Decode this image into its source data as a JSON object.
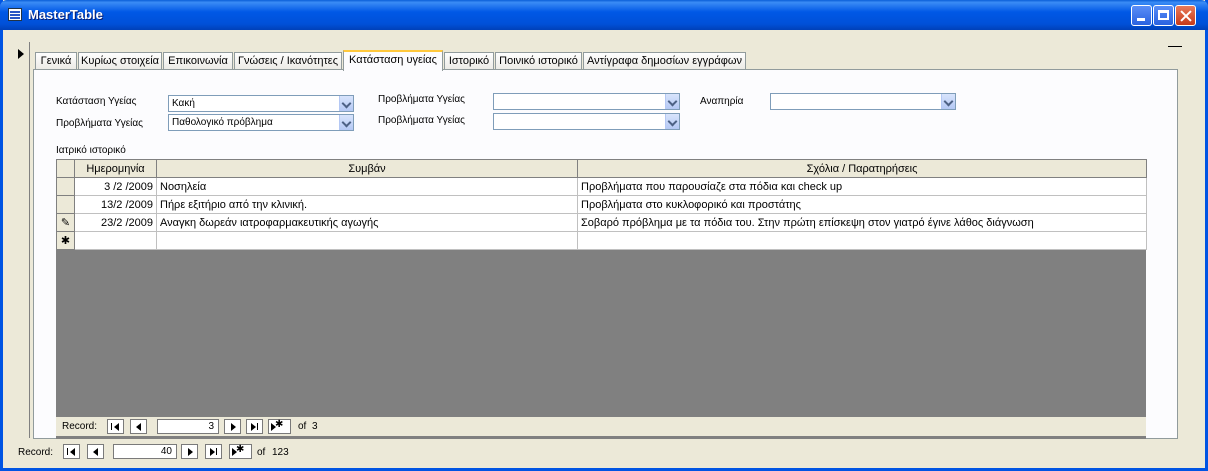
{
  "window": {
    "title": "MasterTable"
  },
  "tabs": [
    {
      "label": "Γενικά"
    },
    {
      "label": "Κυρίως στοιχεία"
    },
    {
      "label": "Επικοινωνία"
    },
    {
      "label": "Γνώσεις / Ικανότητες"
    },
    {
      "label": "Κατάσταση υγείας"
    },
    {
      "label": "Ιστορικό"
    },
    {
      "label": "Ποινικό ιστορικό"
    },
    {
      "label": "Αντίγραφα δημοσίων εγγράφων"
    }
  ],
  "active_tab": "Κατάσταση υγείας",
  "form": {
    "health_status_label": "Κατάσταση Υγείας",
    "health_status_value": "Κακή",
    "health_problems_label": "Προβλήματα Υγείας",
    "health_problems_value": "Παθολογικό πρόβλημα",
    "health_problems2_label": "Προβλήματα Υγείας",
    "health_problems2_value": "",
    "health_problems3_label": "Προβλήματα Υγείας",
    "health_problems3_value": "",
    "disability_label": "Αναπηρία",
    "disability_value": "",
    "medical_history_label": "Ιατρικό ιστορικό"
  },
  "subform": {
    "columns": [
      "Ημερομηνία",
      "Συμβάν",
      "Σχόλια / Παρατηρήσεις"
    ],
    "rows": [
      {
        "date": "3 /2 /2009",
        "event": "Νοσηλεία",
        "notes": "Προβλήματα που παρουσίαζε στα πόδια και check up",
        "marker": ""
      },
      {
        "date": "13/2 /2009",
        "event": "Πήρε εξιτήριο από την κλινική.",
        "notes": "Προβλήματα στο κυκλοφορικό και προστάτης",
        "marker": ""
      },
      {
        "date": "23/2 /2009",
        "event": "Αναγκη δωρεάν ιατροφαρμακευτικής αγωγής",
        "notes": "Σοβαρό πρόβλημα με τα πόδια του. Στην πρώτη επίσκεψη στον γιατρό έγινε λάθος διάγνωση",
        "marker": "✎"
      }
    ],
    "new_row_marker": "✱",
    "nav": {
      "label": "Record:",
      "current": "3",
      "of_label": "of",
      "total": "3"
    }
  },
  "main_nav": {
    "label": "Record:",
    "current": "40",
    "of_label": "of",
    "total": "123"
  },
  "colors": {
    "titlebar": "#0054e3",
    "tab_highlight": "#ffc83c",
    "subform_bg": "#808080"
  }
}
